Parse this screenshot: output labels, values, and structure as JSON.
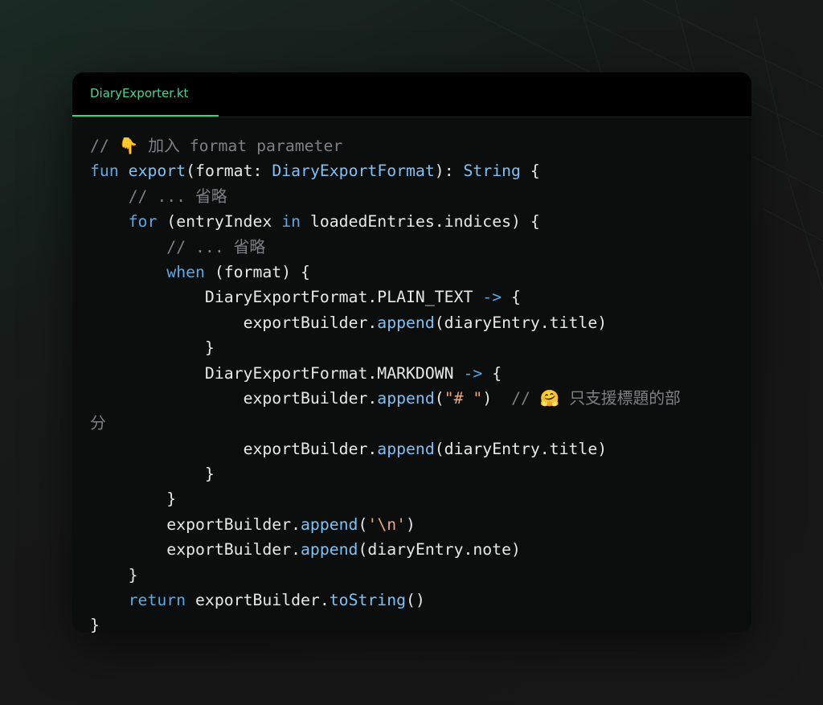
{
  "editor": {
    "tab_label": "DiaryExporter.kt",
    "accent_color": "#47d694"
  },
  "code": {
    "l1_comment": "// 👇 加入 format parameter",
    "l2_kw": "fun",
    "l2_fn": "export",
    "l2_a": "(format: ",
    "l2_type": "DiaryExportFormat",
    "l2_b": "): ",
    "l2_type2": "String",
    "l2_c": " {",
    "l3_comment": "// ... 省略",
    "l4_kw": "for",
    "l4_a": " (entryIndex ",
    "l4_kw2": "in",
    "l4_b": " loadedEntries.indices) {",
    "l5_comment": "// ... 省略",
    "l6_kw": "when",
    "l6_a": " (format) {",
    "l7_a": "DiaryExportFormat.PLAIN_TEXT ",
    "l7_op": "->",
    "l7_b": " {",
    "l8_a": "exportBuilder.",
    "l8_fn": "append",
    "l8_b": "(diaryEntry.title)",
    "l9": "}",
    "l10_a": "DiaryExportFormat.MARKDOWN ",
    "l10_op": "->",
    "l10_b": " {",
    "l11_a": "exportBuilder.",
    "l11_fn": "append",
    "l11_b": "(",
    "l11_str": "\"# \"",
    "l11_c": ")  ",
    "l11_comment": "// 🤗 只支援標題的部",
    "l11_wrap": "分",
    "l12_a": "exportBuilder.",
    "l12_fn": "append",
    "l12_b": "(diaryEntry.title)",
    "l13": "}",
    "l14": "}",
    "l15_a": "exportBuilder.",
    "l15_fn": "append",
    "l15_b": "(",
    "l15_str": "'\\n'",
    "l15_c": ")",
    "l16_a": "exportBuilder.",
    "l16_fn": "append",
    "l16_b": "(diaryEntry.note)",
    "l17": "}",
    "l18_kw": "return",
    "l18_a": " exportBuilder.",
    "l18_fn": "toString",
    "l18_b": "()",
    "l19": "}"
  }
}
